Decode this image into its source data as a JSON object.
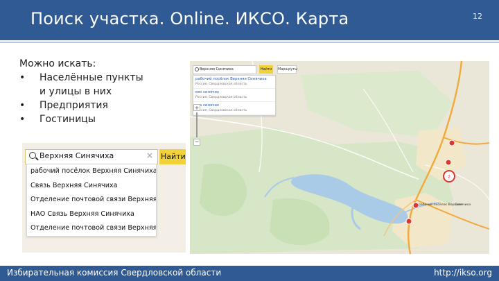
{
  "header": {
    "title": "Поиск участка. Online. ИКСО. Карта",
    "slide_number": "12"
  },
  "content": {
    "lead": "Можно искать:",
    "bullets": [
      {
        "marker": "•",
        "text": "Населённые пункты",
        "cont": "и улицы в них"
      },
      {
        "marker": "•",
        "text": "Предприятия"
      },
      {
        "marker": "•",
        "text": "Гостиницы"
      }
    ]
  },
  "search_example": {
    "query": "Верхняя Синячиха",
    "clear_icon": "×",
    "find_label": "Найти",
    "suggestions": [
      "рабочий посёлок Верхняя Синячиха",
      "Связь Верхняя Синячиха",
      "Отделение почтовой связи Верхняя...",
      "НАО Связь Верхняя Синячиха",
      "Отделение почтовой связи Верхняя"
    ]
  },
  "map": {
    "search_value": "Верхняя Синячиха",
    "find_label": "Найти",
    "route_label": "Маршруты",
    "suggestions": [
      {
        "name": "рабочий посёлок Верхняя Синячиха",
        "sub": "Россия, Свердловская область"
      },
      {
        "name": "вяз синячих",
        "sub": "Россия, Свердловская область"
      },
      {
        "name": "вяз синячих",
        "sub": "Россия, Свердловская область"
      }
    ],
    "zoom_in": "+",
    "zoom_out": "−",
    "marker_label": "2",
    "place_labels": [
      "рабочий посёлок Верхняя",
      "Синячиха"
    ],
    "colors": {
      "land": "#ebe7d8",
      "forest": "#cfe3bd",
      "water": "#a9cbe8",
      "road_main": "#f2a93b",
      "road_minor": "#ffffff",
      "marker": "#e0342e"
    }
  },
  "footer": {
    "left": "Избирательная комиссия Свердловской области",
    "right": "http://ikso.org"
  },
  "theme": {
    "bar_color": "#2f5a94"
  }
}
